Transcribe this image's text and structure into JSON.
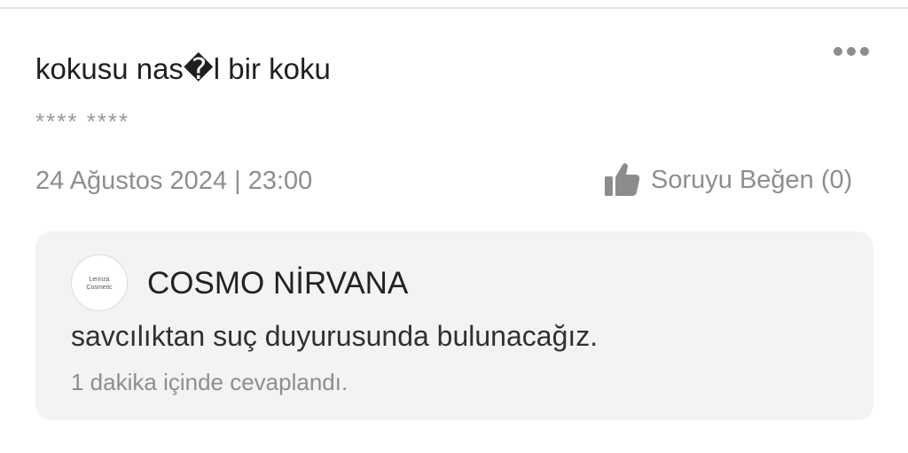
{
  "question": {
    "title": "kokusu nas�l bir koku",
    "asker_masked": "**** ****",
    "date_time": "24 Ağustos 2024 | 23:00",
    "like_label": "Soruyu Beğen (0)",
    "more_icon": "more-dots-icon",
    "like_icon": "thumbs-up-icon"
  },
  "answer": {
    "seller_name": "COSMO NİRVANA",
    "avatar_logo": {
      "line1": "Lerinza",
      "line2": "Cosmetic"
    },
    "text": "savcılıktan suç duyurusunda bulunacağız.",
    "answered_time": "1 dakika içinde cevaplandı."
  },
  "colors": {
    "title": "#1f1f1f",
    "muted": "#8e8e8e",
    "answer_bg": "#f3f3f3",
    "icon": "#8c8c8c"
  }
}
